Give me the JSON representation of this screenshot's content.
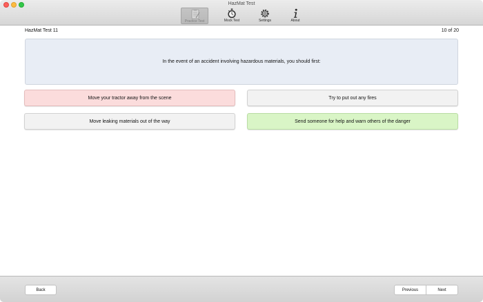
{
  "window": {
    "title": "HazMat Test"
  },
  "toolbar": {
    "items": [
      {
        "label": "Practice Test",
        "icon": "clipboard-icon",
        "active": true
      },
      {
        "label": "Mock Test",
        "icon": "stopwatch-icon",
        "active": false
      },
      {
        "label": "Settings",
        "icon": "gear-icon",
        "active": false
      },
      {
        "label": "About",
        "icon": "info-icon",
        "active": false
      }
    ]
  },
  "header": {
    "test_name": "HazMat Test 11",
    "progress": "10 of 20"
  },
  "question": {
    "text": "In the event of an accident involving hazardous materials, you should first:"
  },
  "answers": [
    {
      "text": "Move your tractor away from the scene",
      "state": "wrong"
    },
    {
      "text": "Try to put out any fires",
      "state": "neutral"
    },
    {
      "text": "Move leaking materials out of the way",
      "state": "neutral"
    },
    {
      "text": "Send someone for help and warn others of the danger",
      "state": "correct"
    }
  ],
  "footer": {
    "back_label": "Back",
    "previous_label": "Previous",
    "next_label": "Next"
  },
  "colors": {
    "question_bg": "#e8edf5",
    "wrong_bg": "#fbdcdc",
    "neutral_bg": "#f2f2f2",
    "correct_bg": "#d9f5c6"
  }
}
